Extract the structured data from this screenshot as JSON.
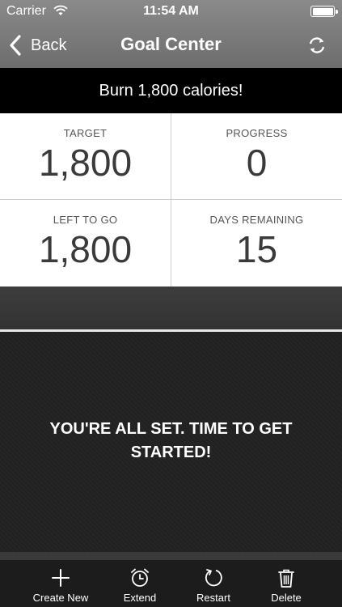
{
  "status_bar": {
    "carrier": "Carrier",
    "time": "11:54 AM"
  },
  "nav": {
    "back_label": "Back",
    "title": "Goal Center"
  },
  "goal": {
    "banner": "Burn 1,800 calories!"
  },
  "stats": [
    {
      "label": "TARGET",
      "value": "1,800"
    },
    {
      "label": "PROGRESS",
      "value": "0"
    },
    {
      "label": "LEFT  TO GO",
      "value": "1,800"
    },
    {
      "label": "DAYS REMAINING",
      "value": "15"
    }
  ],
  "message": "YOU'RE ALL SET. TIME TO GET STARTED!",
  "tabbar": [
    {
      "label": "Create New",
      "icon": "plus-icon"
    },
    {
      "label": "Extend",
      "icon": "alarm-clock-icon"
    },
    {
      "label": "Restart",
      "icon": "restart-icon"
    },
    {
      "label": "Delete",
      "icon": "trash-icon"
    }
  ],
  "colors": {
    "nav": "#7a7a7a",
    "banner": "#000000",
    "panel": "#242424",
    "tabbar": "#1c1c1c"
  }
}
